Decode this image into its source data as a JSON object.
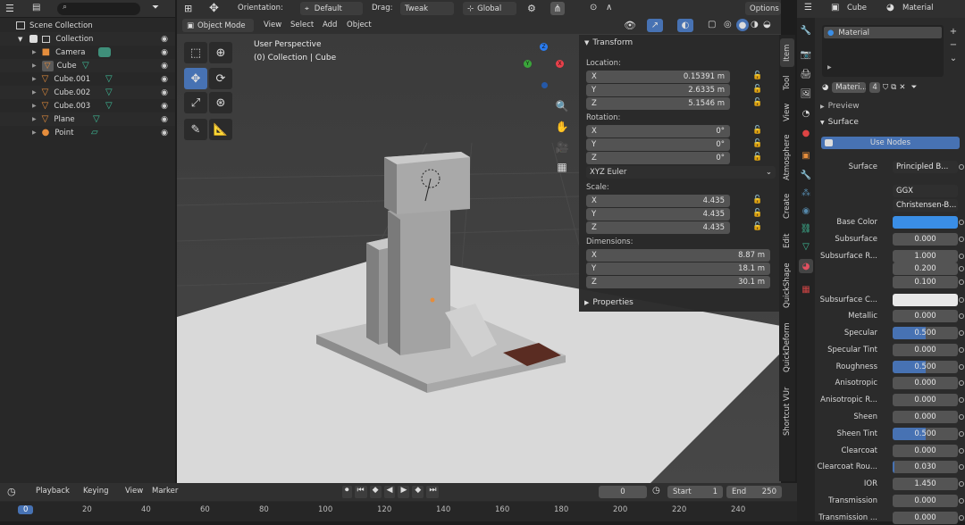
{
  "outliner": {
    "search_placeholder": "",
    "items": [
      {
        "label": "Scene Collection"
      },
      {
        "label": "Collection"
      },
      {
        "label": "Camera"
      },
      {
        "label": "Cube"
      },
      {
        "label": "Cube.001"
      },
      {
        "label": "Cube.002"
      },
      {
        "label": "Cube.003"
      },
      {
        "label": "Plane"
      },
      {
        "label": "Point"
      }
    ]
  },
  "viewport": {
    "header": {
      "orientation_label": "Orientation:",
      "orientation_value": "Default",
      "drag_label": "Drag:",
      "drag_value": "Tweak",
      "transform_space": "Global",
      "options": "Options"
    },
    "menu": {
      "mode": "Object Mode",
      "view": "View",
      "select": "Select",
      "add": "Add",
      "object": "Object"
    },
    "overlay_text": {
      "line1": "User Perspective",
      "line2": "(0) Collection | Cube"
    },
    "gizmo": {
      "x": "X",
      "y": "Y",
      "z": "Z"
    }
  },
  "npanel": {
    "transform_title": "Transform",
    "location_label": "Location:",
    "location": [
      {
        "axis": "X",
        "value": "0.15391 m"
      },
      {
        "axis": "Y",
        "value": "2.6335 m"
      },
      {
        "axis": "Z",
        "value": "5.1546 m"
      }
    ],
    "rotation_label": "Rotation:",
    "rotation": [
      {
        "axis": "X",
        "value": "0°"
      },
      {
        "axis": "Y",
        "value": "0°"
      },
      {
        "axis": "Z",
        "value": "0°"
      }
    ],
    "rotation_mode": "XYZ Euler",
    "scale_label": "Scale:",
    "scale": [
      {
        "axis": "X",
        "value": "4.435"
      },
      {
        "axis": "Y",
        "value": "4.435"
      },
      {
        "axis": "Z",
        "value": "4.435"
      }
    ],
    "dimensions_label": "Dimensions:",
    "dimensions": [
      {
        "axis": "X",
        "value": "8.87 m"
      },
      {
        "axis": "Y",
        "value": "18.1 m"
      },
      {
        "axis": "Z",
        "value": "30.1 m"
      }
    ],
    "properties_title": "Properties",
    "tabs": [
      "Item",
      "Tool",
      "View",
      "Atmosphere",
      "Create",
      "Edit",
      "QuickShape",
      "QuickDeform",
      "Shortcut VUr"
    ]
  },
  "properties": {
    "header": {
      "object": "Cube",
      "material": "Material"
    },
    "slot_name": "Material",
    "material_name": "Materi...",
    "users": "4",
    "preview": "Preview",
    "surface_section": "Surface",
    "use_nodes": "Use Nodes",
    "surface_label": "Surface",
    "surface_value": "Principled B...",
    "distribution": "GGX",
    "subsurface_method": "Christensen-B...",
    "colors": {
      "base_color": "#3a8ee6",
      "subsurface_color": "#e8e8e8",
      "accent": "#4772b3"
    },
    "fields": [
      {
        "label": "Base Color",
        "value": "",
        "type": "color"
      },
      {
        "label": "Subsurface",
        "value": "0.000",
        "fill": 0
      },
      {
        "label": "Subsurface R...",
        "value": "1.000",
        "fill": 0
      },
      {
        "label": "",
        "value": "0.200",
        "fill": 0
      },
      {
        "label": "",
        "value": "0.100",
        "fill": 0
      },
      {
        "label": "Subsurface C...",
        "value": "",
        "type": "color2"
      },
      {
        "label": "Metallic",
        "value": "0.000",
        "fill": 0
      },
      {
        "label": "Specular",
        "value": "0.500",
        "fill": 0.5
      },
      {
        "label": "Specular Tint",
        "value": "0.000",
        "fill": 0
      },
      {
        "label": "Roughness",
        "value": "0.500",
        "fill": 0.5
      },
      {
        "label": "Anisotropic",
        "value": "0.000",
        "fill": 0
      },
      {
        "label": "Anisotropic R...",
        "value": "0.000",
        "fill": 0
      },
      {
        "label": "Sheen",
        "value": "0.000",
        "fill": 0
      },
      {
        "label": "Sheen Tint",
        "value": "0.500",
        "fill": 0.5
      },
      {
        "label": "Clearcoat",
        "value": "0.000",
        "fill": 0
      },
      {
        "label": "Clearcoat Rou...",
        "value": "0.030",
        "fill": 0.03
      },
      {
        "label": "IOR",
        "value": "1.450",
        "fill": 0
      },
      {
        "label": "Transmission",
        "value": "0.000",
        "fill": 0
      },
      {
        "label": "Transmission ...",
        "value": "0.000",
        "fill": 0
      }
    ]
  },
  "timeline": {
    "playback": "Playback",
    "keying": "Keying",
    "view": "View",
    "marker": "Marker",
    "current_frame": "0",
    "start_label": "Start",
    "start": "1",
    "end_label": "End",
    "end": "250",
    "ticks": [
      "0",
      "20",
      "40",
      "60",
      "80",
      "100",
      "120",
      "140",
      "160",
      "180",
      "200",
      "220",
      "240"
    ]
  }
}
